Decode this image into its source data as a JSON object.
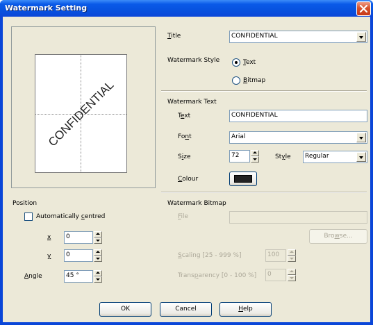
{
  "window": {
    "title": "Watermark Setting"
  },
  "preview": {
    "watermark_text": "CONFIDENTIAL"
  },
  "position": {
    "heading": "Position",
    "auto_centred": {
      "pre": "Automatically ",
      "accel": "c",
      "post": "entred",
      "checked": false
    },
    "x": {
      "accel": "x",
      "value": "0"
    },
    "y": {
      "accel": "y",
      "value": "0"
    },
    "angle": {
      "accel": "A",
      "post": "ngle",
      "value": "45 °"
    }
  },
  "title_row": {
    "accel": "T",
    "post": "itle",
    "value": "CONFIDENTIAL"
  },
  "style": {
    "label": "Watermark Style",
    "text_option": {
      "accel": "T",
      "post": "ext",
      "selected": true
    },
    "bitmap_option": {
      "accel": "B",
      "post": "itmap",
      "selected": false
    }
  },
  "watermark_text": {
    "heading": "Watermark Text",
    "text": {
      "pre": "T",
      "accel": "e",
      "post": "xt",
      "value": "CONFIDENTIAL"
    },
    "font": {
      "pre": "Fo",
      "accel": "n",
      "post": "t",
      "value": "Arial"
    },
    "size": {
      "pre": "S",
      "accel": "i",
      "post": "ze",
      "value": "72"
    },
    "style": {
      "pre": "St",
      "accel": "y",
      "post": "le",
      "value": "Regular"
    },
    "colour": {
      "accel": "C",
      "post": "olour",
      "swatch_color": "#222222"
    }
  },
  "watermark_bitmap": {
    "heading": "Watermark Bitmap",
    "file": {
      "accel": "F",
      "post": "ile",
      "value": ""
    },
    "browse": {
      "pre": "Bro",
      "accel": "w",
      "post": "se..."
    },
    "scaling": {
      "accel": "S",
      "post": "caling [25 - 999 %]",
      "value": "100"
    },
    "transparency": {
      "pre": "Trans",
      "accel": "p",
      "post": "arency [0 - 100 %]",
      "value": "0"
    }
  },
  "buttons": {
    "ok": "OK",
    "cancel": "Cancel",
    "help": {
      "accel": "H",
      "post": "elp"
    }
  }
}
